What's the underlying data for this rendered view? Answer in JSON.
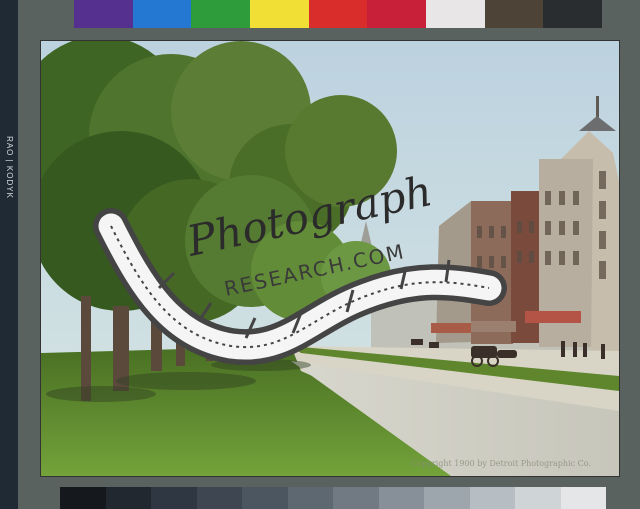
{
  "side_label": "RAO | KODYK",
  "top_swatches": [
    "#56308e",
    "#2478d1",
    "#2f9c3c",
    "#f1df36",
    "#d92d2c",
    "#c9203a",
    "#e8e6e6",
    "#4d4337",
    "#2a2d2f"
  ],
  "bottom_grays": [
    "#15191d",
    "#222830",
    "#2f3742",
    "#3d4651",
    "#4c5661",
    "#5e6871",
    "#717a82",
    "#879098",
    "#9ea6ad",
    "#b7bec3",
    "#cfd4d7",
    "#e4e6e8"
  ],
  "photo": {
    "credit": "Copyright 1900 by Detroit Photographic Co.",
    "sky": "#bfd7e3",
    "grass": "#5c8e2b",
    "path": "#d9d8cf"
  },
  "watermark": {
    "script_text": "Photograph",
    "site_text": "RESEARCH.COM",
    "film": "#4b4b4b"
  }
}
